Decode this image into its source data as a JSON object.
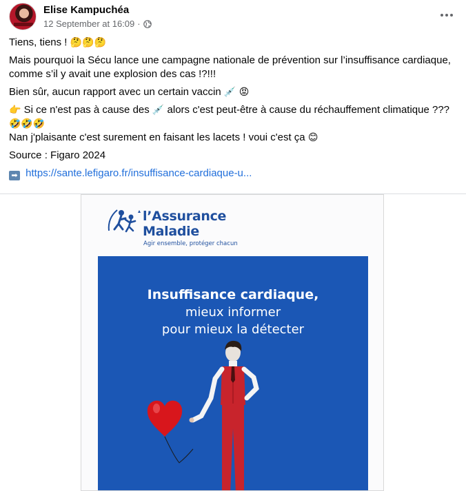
{
  "post": {
    "author": "Elise Kampuchéa",
    "timestamp": "12 September at 16:09",
    "separator": "·",
    "privacy_icon": "globe-icon",
    "more_icon": "more-horizontal-icon"
  },
  "body": {
    "line1": "Tiens, tiens !",
    "line1_emoji": "🤔🤔🤔",
    "line2": "Mais pourquoi la Sécu lance une campagne nationale de prévention sur l’insuffisance cardiaque, comme s’il y avait une explosion des cas !?!!!",
    "line3": "Bien sûr, aucun rapport avec un certain vaccin",
    "line3_emoji": "💉 😡",
    "line4_emoji_start": "👉",
    "line4_a": "Si ce n'est pas à cause des",
    "line4_emoji_mid": "💉",
    "line4_b": "alors c'est peut-être à cause du réchauffement climatique ???",
    "line4_emoji_end": "🤣🤣🤣",
    "line5": "Nan j'plaisante c'est surement en faisant les lacets ! voui c'est ça",
    "line5_emoji": "😊",
    "line6": "Source : Figaro 2024",
    "link_arrow": "➡",
    "link_text": "https://sante.lefigaro.fr/insuffisance-cardiaque-u..."
  },
  "image": {
    "logo_line1": "l’Assurance",
    "logo_line2": "Maladie",
    "logo_tagline": "Agir ensemble, protéger chacun",
    "headline1": "Insuffisance cardiaque,",
    "headline2": "mieux informer",
    "headline3": "pour mieux la détecter",
    "brand_color": "#1f4f9e",
    "panel_color": "#1b57b5",
    "heart_color": "#d8161c"
  }
}
